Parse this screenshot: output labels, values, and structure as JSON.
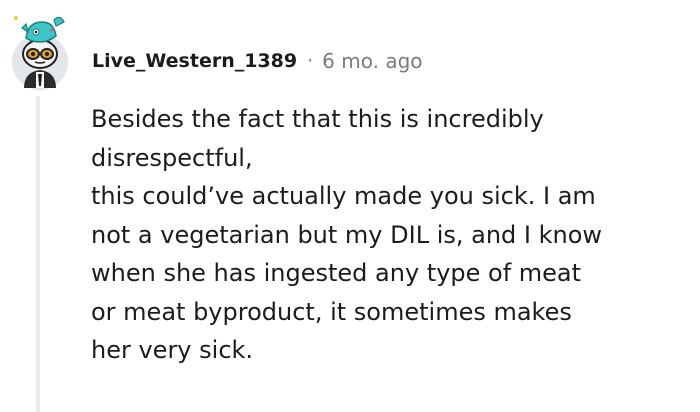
{
  "comment": {
    "author": "Live_Western_1389",
    "separator": "·",
    "timestamp": "6 mo. ago",
    "avatar_icon": "snoo-avatar-icon",
    "body_lines": [
      "Besides the fact that this is incredibly",
      "disrespectful,",
      "this could’ve actually made you sick. I am",
      "not a vegetarian but my DIL is, and I know",
      "when she has ingested any type of meat",
      "or meat byproduct, it sometimes makes",
      "her very sick."
    ]
  },
  "colors": {
    "text": "#1c1c1c",
    "meta": "#7c7c7c",
    "thread_line": "#e9ebed",
    "avatar_bg": "#e4e7ea",
    "hat": "#3fc5c7"
  }
}
